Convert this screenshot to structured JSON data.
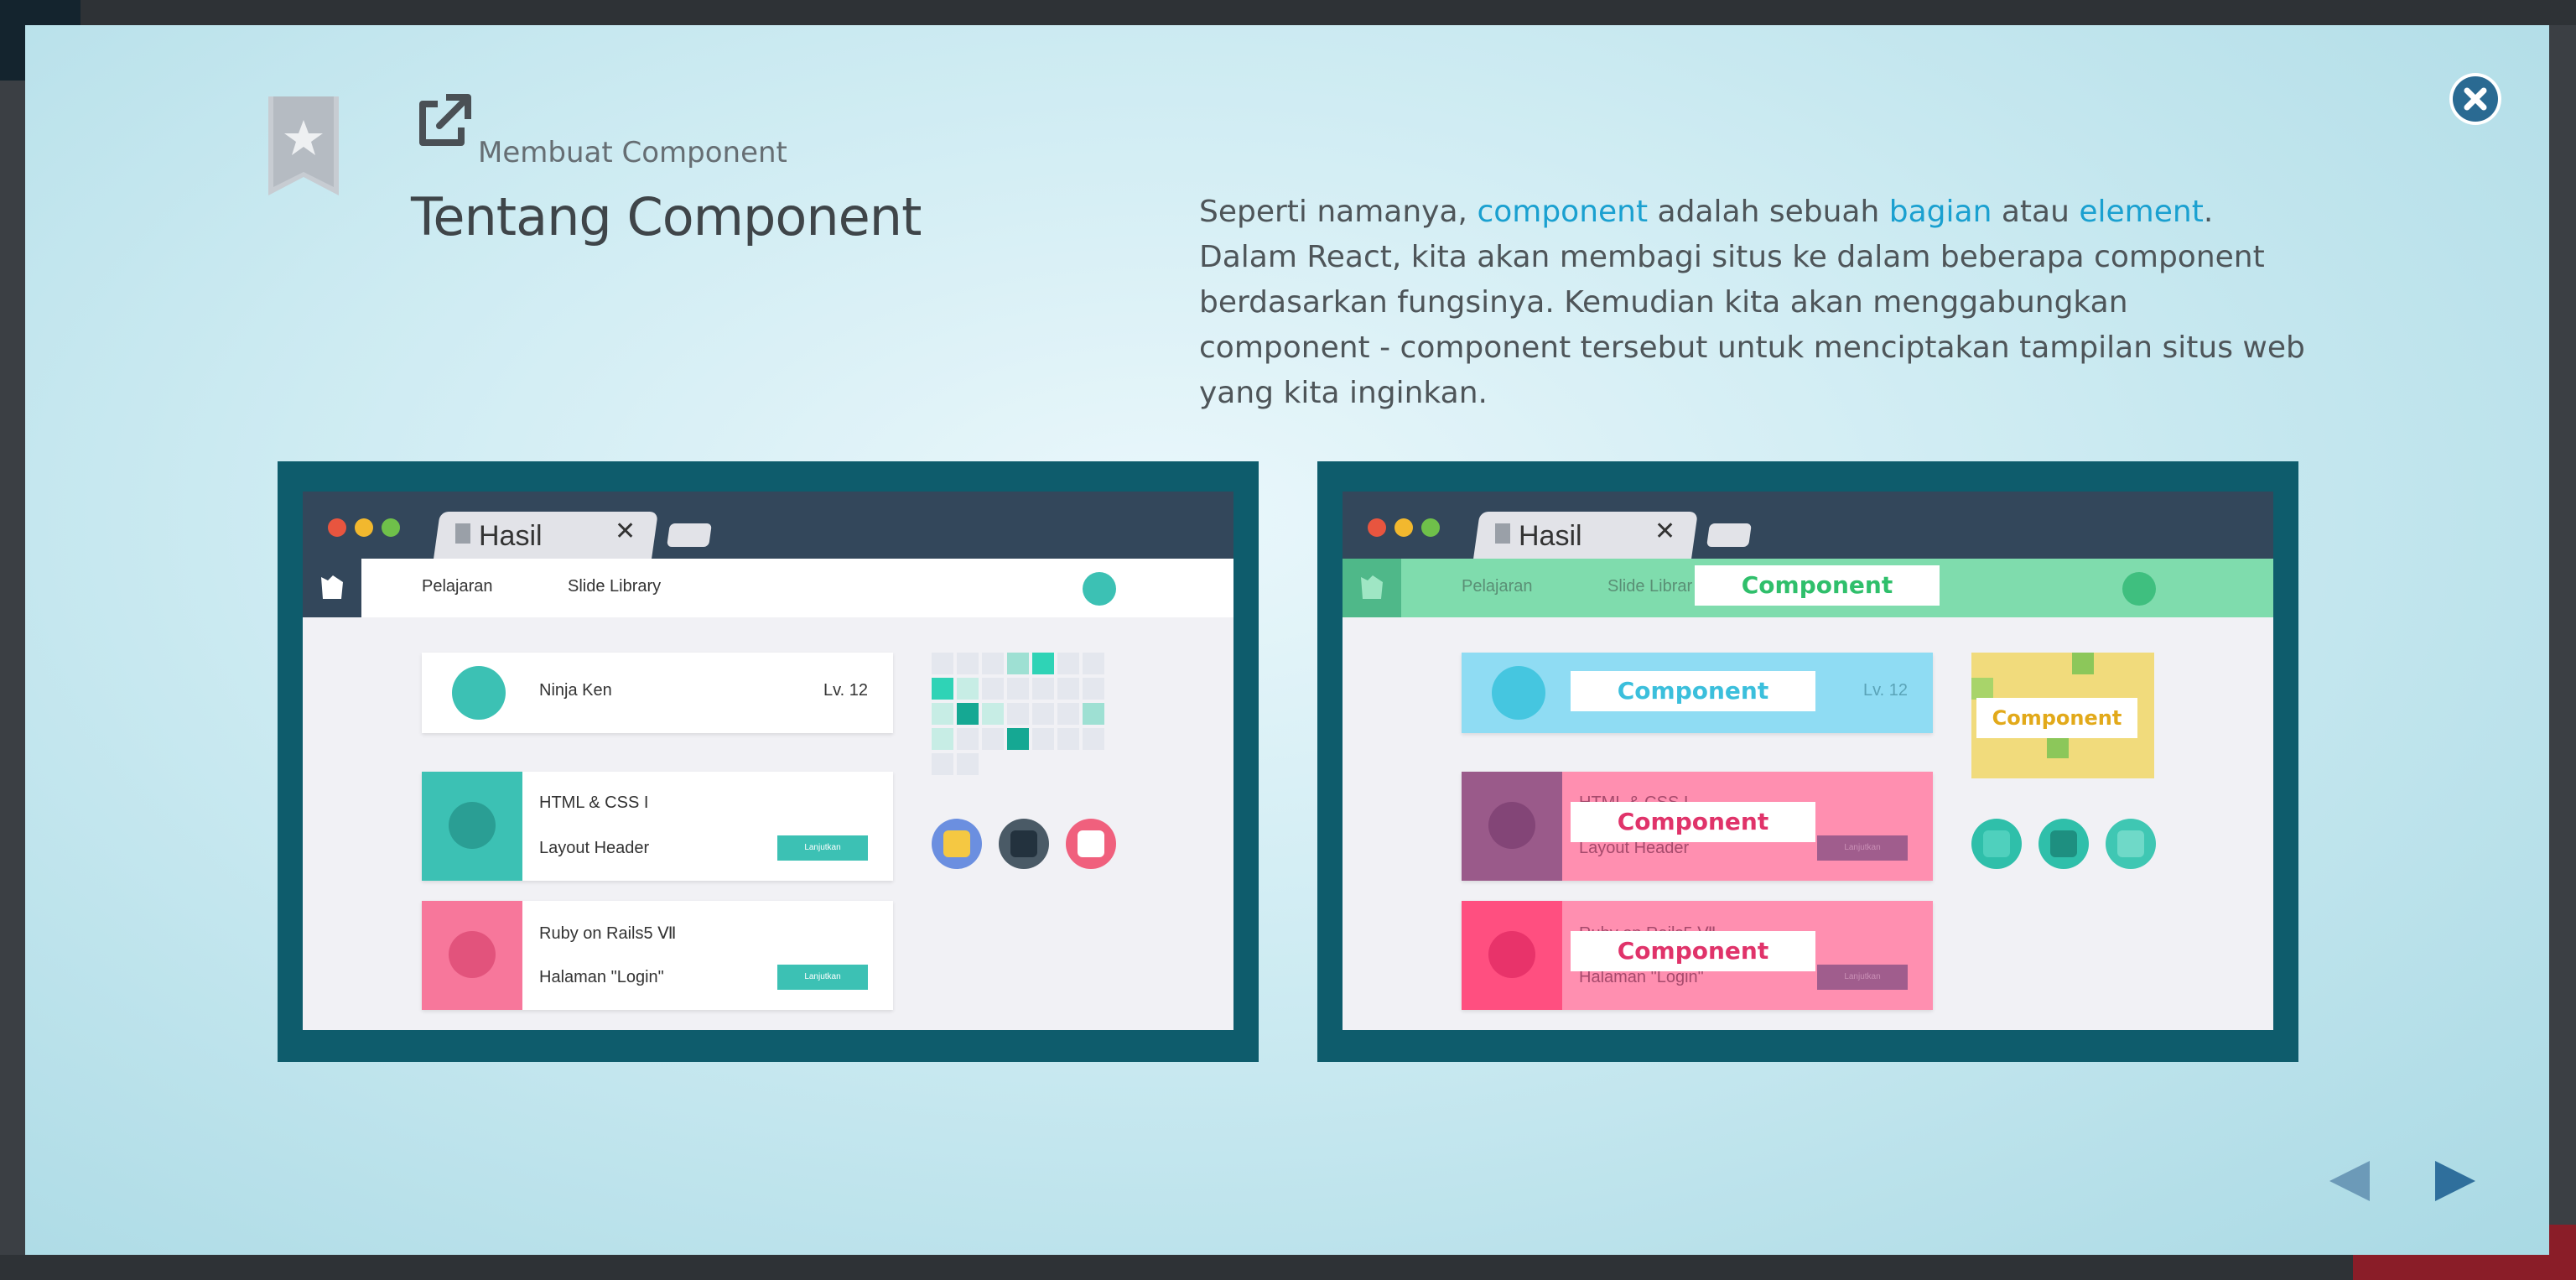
{
  "lesson": {
    "chapter_label": "Membuat Component",
    "title": "Tentang Component"
  },
  "description": {
    "seg1": "Seperti namanya, ",
    "hl1": "component",
    "seg2": " adalah sebuah ",
    "hl2": "bagian",
    "seg3": " atau ",
    "hl3": "element",
    "seg4": ". Dalam React, kita akan membagi situs ke dalam beberapa component berdasarkan fungsinya. Kemudian kita akan menggabungkan component - component tersebut untuk menciptakan tampilan situs web yang kita inginkan."
  },
  "illustration": {
    "tab_title": "Hasil",
    "tab_close": "✕",
    "nav_items": [
      "Pelajaran",
      "Slide Library"
    ],
    "user_name": "Ninja Ken",
    "user_level": "Lv. 12",
    "course1_title": "HTML & CSS I",
    "course1_lesson": "Layout Header",
    "course2_title": "Ruby on Rails5 Ⅶ",
    "course2_lesson": "Halaman \"Login\"",
    "button_label": "Lanjutkan",
    "component_label": "Component",
    "nav_item2_clipped": "Slide Librar"
  },
  "icons": {
    "bookmark": "star-bookmark-icon",
    "external": "external-link-icon",
    "close": "close-circle-icon",
    "prev": "arrow-left-icon",
    "next": "arrow-right-icon"
  },
  "colors": {
    "accent_link": "#1aa0d0",
    "teal": "#3cc1b4",
    "panel": "#0e5c6c",
    "close_button": "#2a6a92"
  }
}
